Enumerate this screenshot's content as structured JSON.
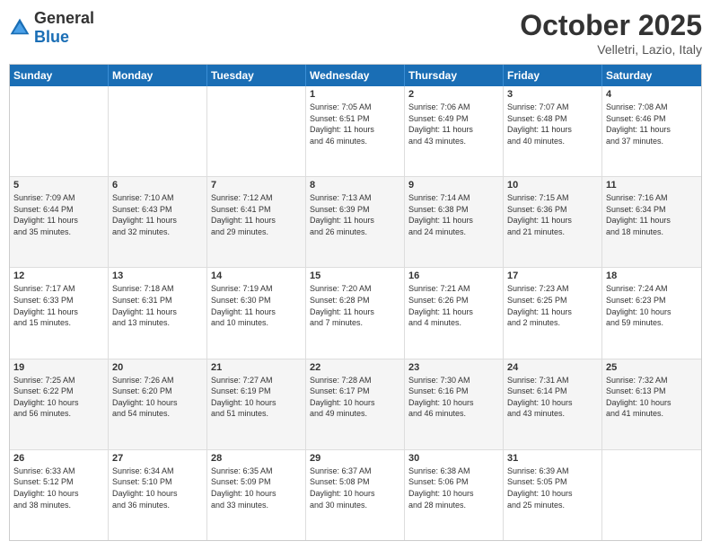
{
  "logo": {
    "general": "General",
    "blue": "Blue"
  },
  "header": {
    "month": "October 2025",
    "location": "Velletri, Lazio, Italy"
  },
  "weekdays": [
    "Sunday",
    "Monday",
    "Tuesday",
    "Wednesday",
    "Thursday",
    "Friday",
    "Saturday"
  ],
  "weeks": [
    [
      {
        "day": "",
        "lines": []
      },
      {
        "day": "",
        "lines": []
      },
      {
        "day": "",
        "lines": []
      },
      {
        "day": "1",
        "lines": [
          "Sunrise: 7:05 AM",
          "Sunset: 6:51 PM",
          "Daylight: 11 hours",
          "and 46 minutes."
        ]
      },
      {
        "day": "2",
        "lines": [
          "Sunrise: 7:06 AM",
          "Sunset: 6:49 PM",
          "Daylight: 11 hours",
          "and 43 minutes."
        ]
      },
      {
        "day": "3",
        "lines": [
          "Sunrise: 7:07 AM",
          "Sunset: 6:48 PM",
          "Daylight: 11 hours",
          "and 40 minutes."
        ]
      },
      {
        "day": "4",
        "lines": [
          "Sunrise: 7:08 AM",
          "Sunset: 6:46 PM",
          "Daylight: 11 hours",
          "and 37 minutes."
        ]
      }
    ],
    [
      {
        "day": "5",
        "lines": [
          "Sunrise: 7:09 AM",
          "Sunset: 6:44 PM",
          "Daylight: 11 hours",
          "and 35 minutes."
        ]
      },
      {
        "day": "6",
        "lines": [
          "Sunrise: 7:10 AM",
          "Sunset: 6:43 PM",
          "Daylight: 11 hours",
          "and 32 minutes."
        ]
      },
      {
        "day": "7",
        "lines": [
          "Sunrise: 7:12 AM",
          "Sunset: 6:41 PM",
          "Daylight: 11 hours",
          "and 29 minutes."
        ]
      },
      {
        "day": "8",
        "lines": [
          "Sunrise: 7:13 AM",
          "Sunset: 6:39 PM",
          "Daylight: 11 hours",
          "and 26 minutes."
        ]
      },
      {
        "day": "9",
        "lines": [
          "Sunrise: 7:14 AM",
          "Sunset: 6:38 PM",
          "Daylight: 11 hours",
          "and 24 minutes."
        ]
      },
      {
        "day": "10",
        "lines": [
          "Sunrise: 7:15 AM",
          "Sunset: 6:36 PM",
          "Daylight: 11 hours",
          "and 21 minutes."
        ]
      },
      {
        "day": "11",
        "lines": [
          "Sunrise: 7:16 AM",
          "Sunset: 6:34 PM",
          "Daylight: 11 hours",
          "and 18 minutes."
        ]
      }
    ],
    [
      {
        "day": "12",
        "lines": [
          "Sunrise: 7:17 AM",
          "Sunset: 6:33 PM",
          "Daylight: 11 hours",
          "and 15 minutes."
        ]
      },
      {
        "day": "13",
        "lines": [
          "Sunrise: 7:18 AM",
          "Sunset: 6:31 PM",
          "Daylight: 11 hours",
          "and 13 minutes."
        ]
      },
      {
        "day": "14",
        "lines": [
          "Sunrise: 7:19 AM",
          "Sunset: 6:30 PM",
          "Daylight: 11 hours",
          "and 10 minutes."
        ]
      },
      {
        "day": "15",
        "lines": [
          "Sunrise: 7:20 AM",
          "Sunset: 6:28 PM",
          "Daylight: 11 hours",
          "and 7 minutes."
        ]
      },
      {
        "day": "16",
        "lines": [
          "Sunrise: 7:21 AM",
          "Sunset: 6:26 PM",
          "Daylight: 11 hours",
          "and 4 minutes."
        ]
      },
      {
        "day": "17",
        "lines": [
          "Sunrise: 7:23 AM",
          "Sunset: 6:25 PM",
          "Daylight: 11 hours",
          "and 2 minutes."
        ]
      },
      {
        "day": "18",
        "lines": [
          "Sunrise: 7:24 AM",
          "Sunset: 6:23 PM",
          "Daylight: 10 hours",
          "and 59 minutes."
        ]
      }
    ],
    [
      {
        "day": "19",
        "lines": [
          "Sunrise: 7:25 AM",
          "Sunset: 6:22 PM",
          "Daylight: 10 hours",
          "and 56 minutes."
        ]
      },
      {
        "day": "20",
        "lines": [
          "Sunrise: 7:26 AM",
          "Sunset: 6:20 PM",
          "Daylight: 10 hours",
          "and 54 minutes."
        ]
      },
      {
        "day": "21",
        "lines": [
          "Sunrise: 7:27 AM",
          "Sunset: 6:19 PM",
          "Daylight: 10 hours",
          "and 51 minutes."
        ]
      },
      {
        "day": "22",
        "lines": [
          "Sunrise: 7:28 AM",
          "Sunset: 6:17 PM",
          "Daylight: 10 hours",
          "and 49 minutes."
        ]
      },
      {
        "day": "23",
        "lines": [
          "Sunrise: 7:30 AM",
          "Sunset: 6:16 PM",
          "Daylight: 10 hours",
          "and 46 minutes."
        ]
      },
      {
        "day": "24",
        "lines": [
          "Sunrise: 7:31 AM",
          "Sunset: 6:14 PM",
          "Daylight: 10 hours",
          "and 43 minutes."
        ]
      },
      {
        "day": "25",
        "lines": [
          "Sunrise: 7:32 AM",
          "Sunset: 6:13 PM",
          "Daylight: 10 hours",
          "and 41 minutes."
        ]
      }
    ],
    [
      {
        "day": "26",
        "lines": [
          "Sunrise: 6:33 AM",
          "Sunset: 5:12 PM",
          "Daylight: 10 hours",
          "and 38 minutes."
        ]
      },
      {
        "day": "27",
        "lines": [
          "Sunrise: 6:34 AM",
          "Sunset: 5:10 PM",
          "Daylight: 10 hours",
          "and 36 minutes."
        ]
      },
      {
        "day": "28",
        "lines": [
          "Sunrise: 6:35 AM",
          "Sunset: 5:09 PM",
          "Daylight: 10 hours",
          "and 33 minutes."
        ]
      },
      {
        "day": "29",
        "lines": [
          "Sunrise: 6:37 AM",
          "Sunset: 5:08 PM",
          "Daylight: 10 hours",
          "and 30 minutes."
        ]
      },
      {
        "day": "30",
        "lines": [
          "Sunrise: 6:38 AM",
          "Sunset: 5:06 PM",
          "Daylight: 10 hours",
          "and 28 minutes."
        ]
      },
      {
        "day": "31",
        "lines": [
          "Sunrise: 6:39 AM",
          "Sunset: 5:05 PM",
          "Daylight: 10 hours",
          "and 25 minutes."
        ]
      },
      {
        "day": "",
        "lines": []
      }
    ]
  ]
}
